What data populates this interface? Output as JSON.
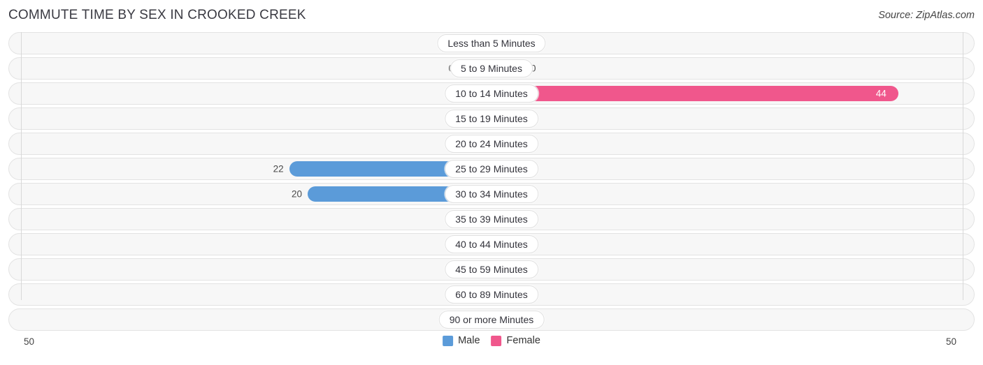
{
  "header": {
    "title": "COMMUTE TIME BY SEX IN CROOKED CREEK",
    "source": "Source: ZipAtlas.com"
  },
  "axis": {
    "left_tick": "50",
    "right_tick": "50"
  },
  "legend": {
    "items": [
      {
        "label": "Male",
        "color": "#5b9bd9"
      },
      {
        "label": "Female",
        "color": "#f0578c"
      }
    ]
  },
  "colors": {
    "male_filled": "#5b9bd9",
    "male_empty": "#a8cae9",
    "female_filled": "#f0578c",
    "female_empty": "#f5a6c3",
    "row_track": "#f7f7f7",
    "row_border": "#e3e3e3"
  },
  "chart_data": {
    "type": "bar",
    "title": "COMMUTE TIME BY SEX IN CROOKED CREEK",
    "subtitle": "Source: ZipAtlas.com",
    "orientation": "horizontal-diverging",
    "xlabel": "",
    "ylabel": "",
    "xlim": [
      50,
      50
    ],
    "axis_max": 50,
    "grid": false,
    "legend_position": "bottom-center",
    "categories": [
      "Less than 5 Minutes",
      "5 to 9 Minutes",
      "10 to 14 Minutes",
      "15 to 19 Minutes",
      "20 to 24 Minutes",
      "25 to 29 Minutes",
      "30 to 34 Minutes",
      "35 to 39 Minutes",
      "40 to 44 Minutes",
      "45 to 59 Minutes",
      "60 to 89 Minutes",
      "90 or more Minutes"
    ],
    "series": [
      {
        "name": "Male",
        "color": "#5b9bd9",
        "side": "left",
        "values": [
          0,
          0,
          0,
          0,
          0,
          22,
          20,
          0,
          0,
          0,
          0,
          0
        ],
        "labels": [
          "0",
          "0",
          "0",
          "0",
          "0",
          "22",
          "20",
          "0",
          "0",
          "0",
          "0",
          "0"
        ]
      },
      {
        "name": "Female",
        "color": "#f0578c",
        "side": "right",
        "values": [
          0,
          0,
          44,
          0,
          0,
          0,
          0,
          0,
          0,
          0,
          0,
          0
        ],
        "labels": [
          "0",
          "0",
          "44",
          "0",
          "0",
          "0",
          "0",
          "0",
          "0",
          "0",
          "0",
          "0"
        ]
      }
    ]
  }
}
